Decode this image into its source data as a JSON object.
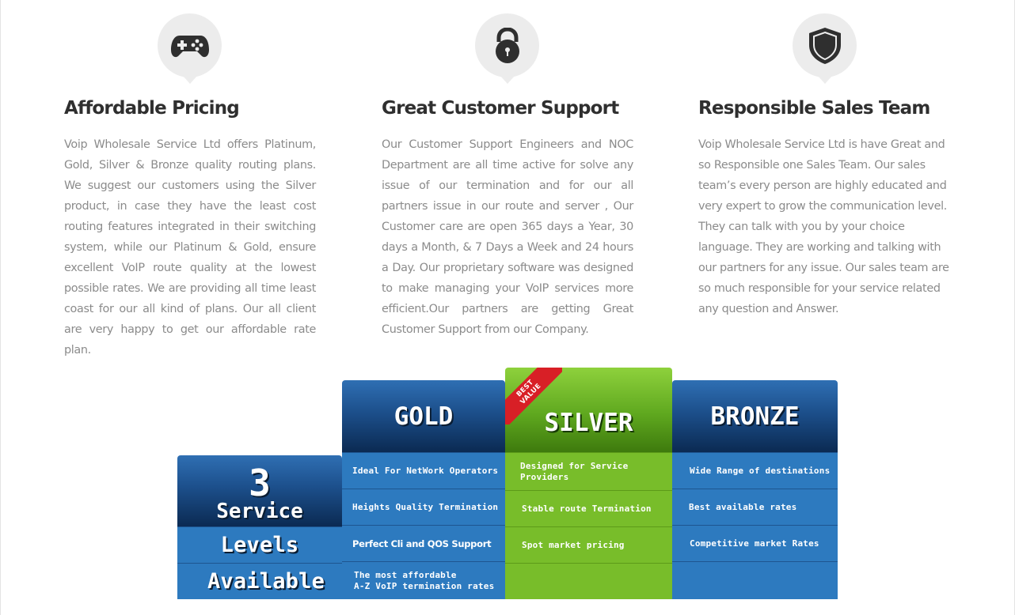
{
  "features": [
    {
      "icon": "gamepad-icon",
      "title": "Affordable Pricing",
      "text": "Voip Wholesale Service Ltd offers Platinum, Gold, Silver & Bronze quality routing plans. We suggest our customers using the Silver product, in case they have the least cost routing features integrated in their switching system, while our Platinum & Gold, ensure excellent VoIP route quality at the lowest possible rates. We are providing all time least coast for our all kind of plans. Our all client are very happy to get our affordable rate plan."
    },
    {
      "icon": "lock-icon",
      "title": "Great Customer Support",
      "text": "Our Customer Support Engineers and NOC Department are all time active for solve any issue of our termination and for our all partners issue in our route and server  , Our Customer care are open 365 days a Year, 30 days a Month, & 7 Days a Week and 24 hours a Day. Our proprietary software was designed to make managing your VoIP services more efficient.Our partners are getting Great Customer Support from our Company."
    },
    {
      "icon": "shield-icon",
      "title": "Responsible Sales Team",
      "text": "Voip Wholesale Service Ltd is have Great and so Responsible one Sales Team. Our sales team’s every person are highly educated and very expert to grow the communication level. They can talk with you by your choice language. They are working and talking with our partners for any issue. Our sales team are so much responsible for your service related any question and Answer."
    }
  ],
  "pricing": {
    "levels": {
      "number": "3",
      "word1": "Service",
      "word2": "Levels",
      "word3": "Available"
    },
    "gold": {
      "title": "GOLD",
      "rows": [
        "Ideal For NetWork Operators",
        "Heights Quality Termination",
        "Perfect Cli and QOS Support",
        "The most affordable\nA-Z VoIP termination rates"
      ]
    },
    "silver": {
      "title": "SILVER",
      "ribbon": "BEST\nVALUE",
      "rows": [
        "Designed for Service\nProviders",
        "Stable route Termination",
        "Spot market pricing",
        ""
      ]
    },
    "bronze": {
      "title": "BRONZE",
      "rows": [
        "Wide Range of destinations",
        "Best available rates",
        "Competitive market Rates",
        ""
      ]
    }
  },
  "colors": {
    "blue_head": "#1c4f8b",
    "blue_cell": "#2d7abf",
    "green": "#78bd2a",
    "ribbon": "#d81f26"
  }
}
